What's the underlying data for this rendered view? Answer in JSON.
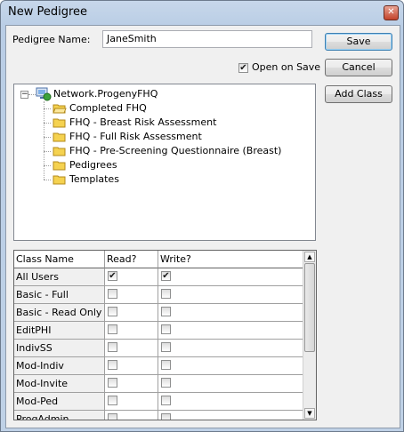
{
  "window": {
    "title": "New Pedigree",
    "close_glyph": "✕"
  },
  "form": {
    "name_label": "Pedigree Name:",
    "name_value": "JaneSmith",
    "open_on_save_label": "Open on Save",
    "open_on_save_checked": true
  },
  "buttons": {
    "save": "Save",
    "cancel": "Cancel",
    "add_class": "Add Class"
  },
  "tree": {
    "root": "Network.ProgenyFHQ",
    "items": [
      "Completed FHQ",
      "FHQ - Breast Risk Assessment",
      "FHQ - Full Risk Assessment",
      "FHQ - Pre-Screening Questionnaire (Breast)",
      "Pedigrees",
      "Templates"
    ]
  },
  "grid": {
    "headers": [
      "Class Name",
      "Read?",
      "Write?"
    ],
    "rows": [
      {
        "name": "All Users",
        "read": true,
        "write": true
      },
      {
        "name": "Basic - Full Access",
        "read": false,
        "write": false
      },
      {
        "name": "Basic - Read Only",
        "read": false,
        "write": false
      },
      {
        "name": "EditPHI",
        "read": false,
        "write": false
      },
      {
        "name": "IndivSS",
        "read": false,
        "write": false
      },
      {
        "name": "Mod-Indiv",
        "read": false,
        "write": false
      },
      {
        "name": "Mod-Invite",
        "read": false,
        "write": false
      },
      {
        "name": "Mod-Ped",
        "read": false,
        "write": false
      },
      {
        "name": "ProgAdmin",
        "read": false,
        "write": false
      }
    ]
  },
  "colors": {
    "title_bg": "#b9cde5",
    "client_bg": "#f0f0f0",
    "folder": "#f5d250"
  }
}
